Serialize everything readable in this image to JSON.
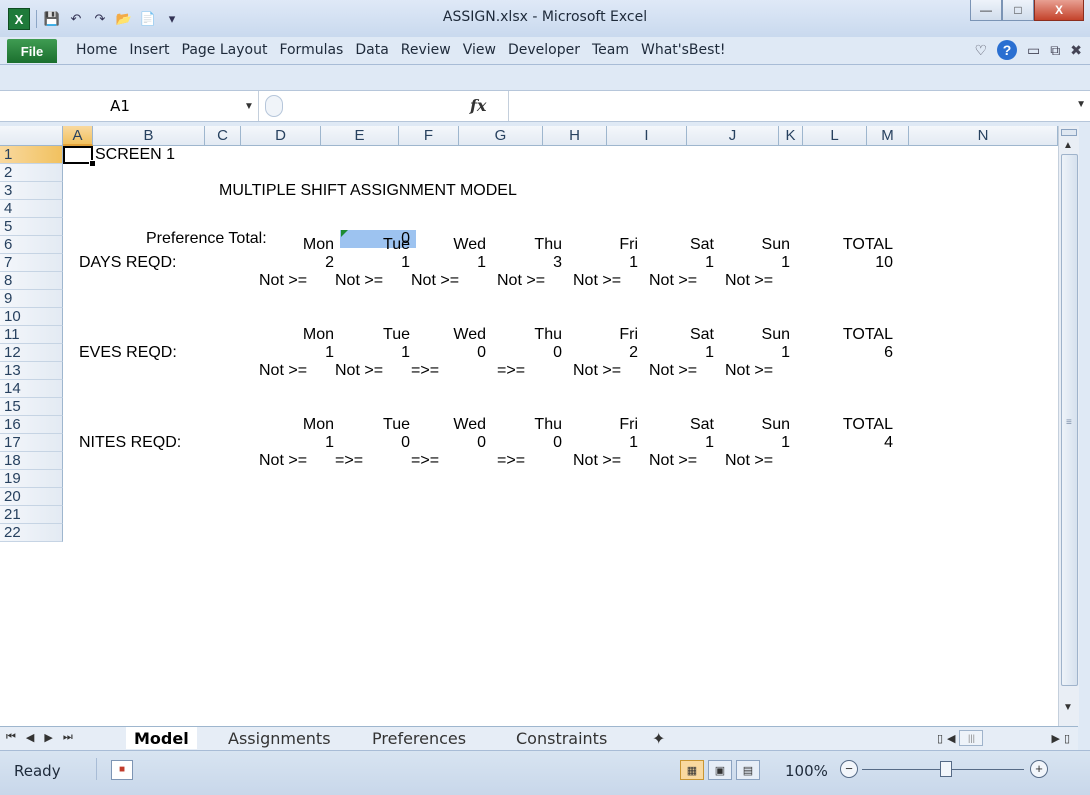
{
  "window": {
    "title": "ASSIGN.xlsx - Microsoft Excel"
  },
  "ribbon": {
    "file_tab": "File",
    "tabs": [
      "Home",
      "Insert",
      "Page Layout",
      "Formulas",
      "Data",
      "Review",
      "View",
      "Developer",
      "Team",
      "What'sBest!"
    ]
  },
  "formula_bar": {
    "name_box": "A1",
    "fx": "fx",
    "formula": ""
  },
  "columns": [
    "A",
    "B",
    "C",
    "D",
    "E",
    "F",
    "G",
    "H",
    "I",
    "J",
    "K",
    "L",
    "M",
    "N"
  ],
  "rows": [
    "1",
    "2",
    "3",
    "4",
    "5",
    "6",
    "7",
    "8",
    "9",
    "10",
    "11",
    "12",
    "13",
    "14",
    "15",
    "16",
    "17",
    "18",
    "19",
    "20",
    "21",
    "22"
  ],
  "sheet": {
    "screen_label": "SCREEN 1",
    "model_title": "MULTIPLE SHIFT ASSIGNMENT MODEL",
    "preference_label": "Preference Total:",
    "preference_value": "0",
    "day_headers": [
      "Mon",
      "Tue",
      "Wed",
      "Thu",
      "Fri",
      "Sat",
      "Sun",
      "TOTAL"
    ],
    "blocks": [
      {
        "label": "DAYS REQD:",
        "values": [
          "2",
          "1",
          "1",
          "3",
          "1",
          "1",
          "1",
          "10"
        ],
        "checks": [
          "Not >=",
          "Not >=",
          "Not >=",
          "Not >=",
          "Not >=",
          "Not >=",
          "Not >="
        ]
      },
      {
        "label": "EVES REQD:",
        "values": [
          "1",
          "1",
          "0",
          "0",
          "2",
          "1",
          "1",
          "6"
        ],
        "checks": [
          "Not >=",
          "Not >=",
          "=>=",
          "=>=",
          "Not >=",
          "Not >=",
          "Not >="
        ]
      },
      {
        "label": "NITES REQD:",
        "values": [
          "1",
          "0",
          "0",
          "0",
          "1",
          "1",
          "1",
          "4"
        ],
        "checks": [
          "Not >=",
          "=>=",
          "=>=",
          "=>=",
          "Not >=",
          "Not >=",
          "Not >="
        ]
      }
    ]
  },
  "sheet_tabs": [
    "Model",
    "Assignments",
    "Preferences",
    "Constraints"
  ],
  "status": {
    "ready": "Ready",
    "zoom": "100%"
  }
}
